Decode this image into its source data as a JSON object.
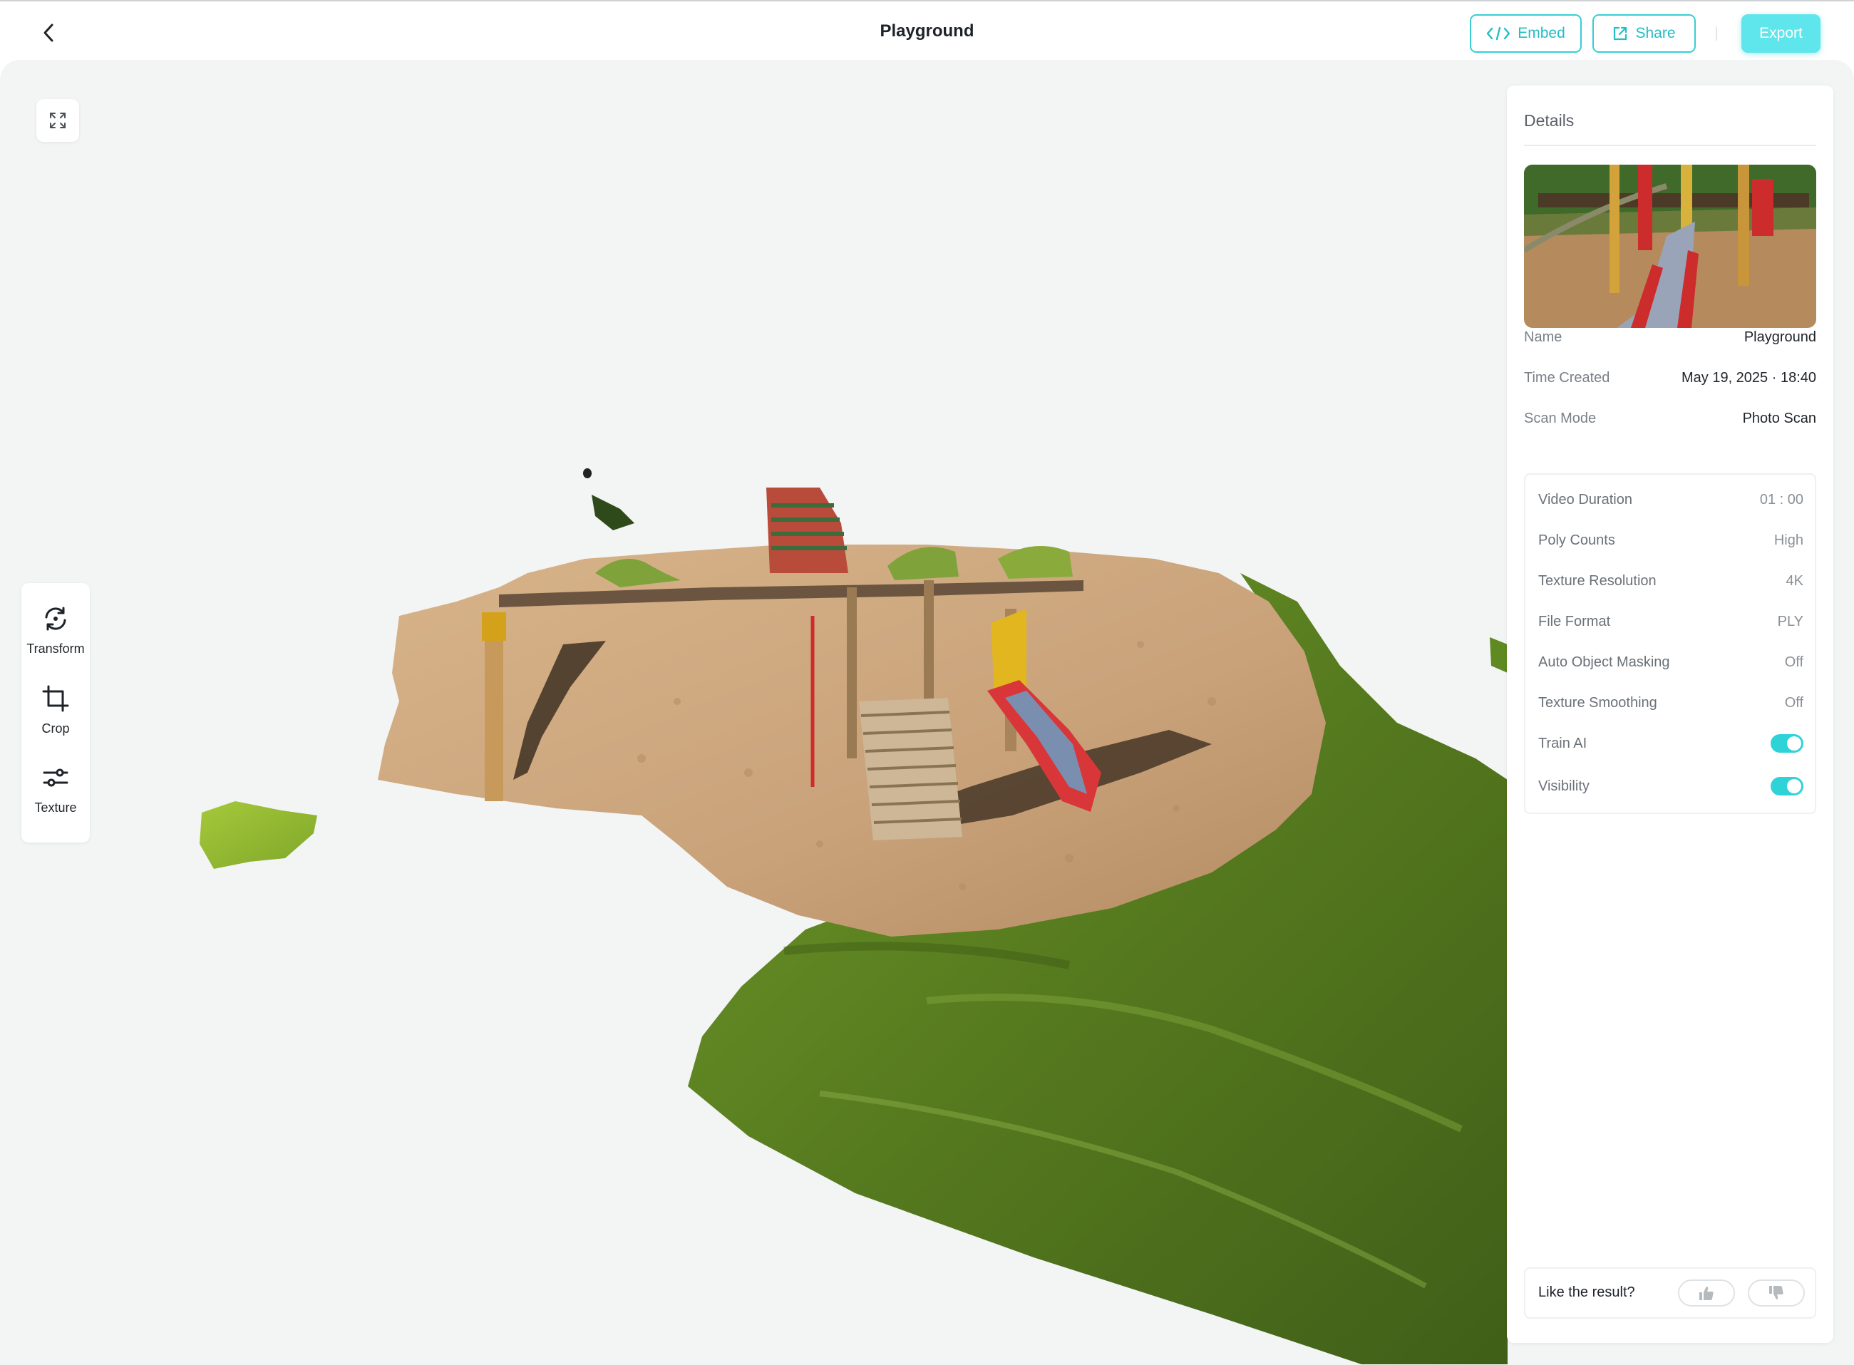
{
  "header": {
    "title": "Playground",
    "embed_label": "Embed",
    "share_label": "Share",
    "export_label": "Export"
  },
  "toolbar": {
    "items": [
      {
        "label": "Transform",
        "icon": "transform-icon"
      },
      {
        "label": "Crop",
        "icon": "crop-icon"
      },
      {
        "label": "Texture",
        "icon": "sliders-icon"
      }
    ]
  },
  "details": {
    "title": "Details",
    "info": [
      {
        "label": "Name",
        "value": "Playground"
      },
      {
        "label": "Time Created",
        "value": "May 19, 2025 · 18:40"
      },
      {
        "label": "Scan Mode",
        "value": "Photo Scan"
      }
    ],
    "specs": [
      {
        "label": "Video Duration",
        "value": "01 : 00"
      },
      {
        "label": "Poly Counts",
        "value": "High"
      },
      {
        "label": "Texture Resolution",
        "value": "4K"
      },
      {
        "label": "File Format",
        "value": "PLY"
      },
      {
        "label": "Auto Object Masking",
        "value": "Off"
      },
      {
        "label": "Texture Smoothing",
        "value": "Off"
      }
    ],
    "toggles": [
      {
        "label": "Train AI",
        "on": true
      },
      {
        "label": "Visibility",
        "on": true
      }
    ],
    "feedback_label": "Like the result?"
  },
  "colors": {
    "accent": "#2ed3d8",
    "export_bg": "#5ee6ec",
    "viewport_bg": "#f3f4f4"
  }
}
